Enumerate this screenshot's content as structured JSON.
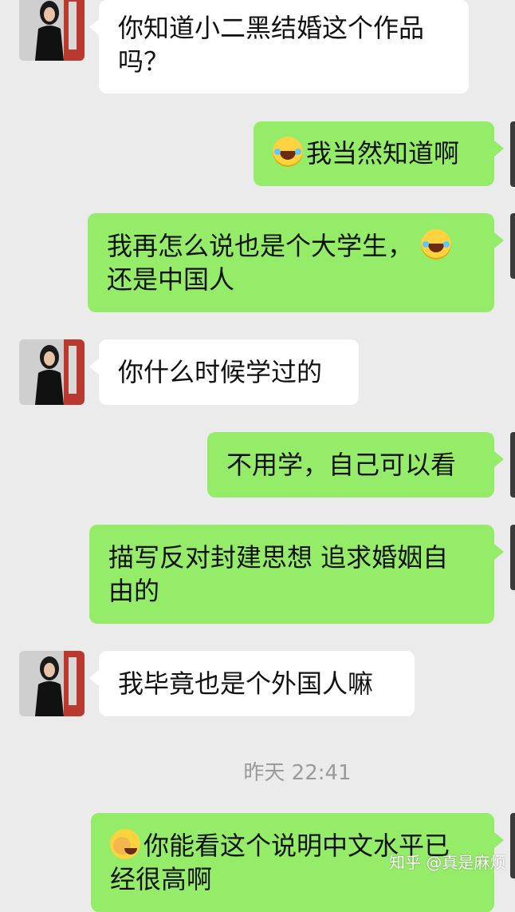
{
  "messages": [
    {
      "side": "left",
      "text": "你知道小二黑结婚这个作品吗？",
      "lines": [
        "你知道小二黑结婚这个作品",
        "吗？"
      ]
    },
    {
      "side": "right",
      "text": "我当然知道啊",
      "emoji": "laugh-cry-emoji"
    },
    {
      "side": "right",
      "lines": [
        "我再怎么说也是个大学生，",
        "还是中国人"
      ],
      "emoji": "laugh-cry-emoji"
    },
    {
      "side": "left",
      "text": "你什么时候学过的"
    },
    {
      "side": "right",
      "text": "不用学，自己可以看"
    },
    {
      "side": "right",
      "lines": [
        "描写反对封建思想 追求婚姻自",
        "由的"
      ]
    },
    {
      "side": "left",
      "text": "我毕竟也是个外国人嘛"
    },
    {
      "side": "right",
      "lines": [
        "你能看这个说明中文水平已",
        "经很高啊"
      ],
      "emoji": "facepalm-emoji"
    }
  ],
  "timestamp": "昨天 22:41",
  "watermark": "知乎 @真是麻烦",
  "colors": {
    "background": "#ebebeb",
    "bubble_left": "#ffffff",
    "bubble_right": "#95ec69",
    "timestamp": "#9a9a9a"
  }
}
